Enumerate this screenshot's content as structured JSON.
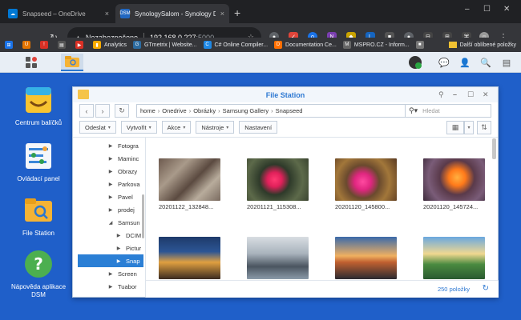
{
  "browser": {
    "tabs": [
      {
        "title": "Snapseed – OneDrive",
        "close": "×"
      },
      {
        "title": "SynologySalom - Synology Diski",
        "close": "×"
      }
    ],
    "new_tab": "+",
    "window_controls": [
      "–",
      "☐",
      "✕"
    ],
    "address": {
      "security": "Nezabezpečeno",
      "host": "192.168.0.227",
      "port": ":5000"
    },
    "bookmarks": [
      "Analytics",
      "GTmetrix | Website...",
      "C# Online Compiler...",
      "Documentation Ce...",
      "MSPRO.CZ - Inform..."
    ],
    "other_bookmarks": "Další oblíbené položky"
  },
  "desktop": {
    "icons": [
      {
        "label": "Centrum balíčků"
      },
      {
        "label": "Ovládací panel"
      },
      {
        "label": "File Station"
      },
      {
        "label": "Nápověda aplikace DSM"
      }
    ]
  },
  "file_station": {
    "title": "File Station",
    "path": [
      "home",
      "Onedrive",
      "Obrázky",
      "Samsung Gallery",
      "Snapseed"
    ],
    "search_placeholder": "Hledat",
    "actions": [
      {
        "label": "Odeslat",
        "has_dropdown": true
      },
      {
        "label": "Vytvořit",
        "has_dropdown": true
      },
      {
        "label": "Akce",
        "has_dropdown": true
      },
      {
        "label": "Nástroje",
        "has_dropdown": true
      },
      {
        "label": "Nastavení",
        "has_dropdown": false
      }
    ],
    "tree": [
      {
        "label": "Fotogra",
        "expanded": false,
        "selected": false
      },
      {
        "label": "Maminc",
        "expanded": false,
        "selected": false
      },
      {
        "label": "Obrazy",
        "expanded": false,
        "selected": false
      },
      {
        "label": "Parkova",
        "expanded": false,
        "selected": false
      },
      {
        "label": "Pavel",
        "expanded": false,
        "selected": false
      },
      {
        "label": "prodej",
        "expanded": false,
        "selected": false
      },
      {
        "label": "Samsun",
        "expanded": true,
        "selected": false
      },
      {
        "label": "DCIM",
        "expanded": false,
        "selected": false
      },
      {
        "label": "Pictur",
        "expanded": false,
        "selected": false
      },
      {
        "label": "Snap",
        "expanded": false,
        "selected": true
      },
      {
        "label": "Screen",
        "expanded": false,
        "selected": false
      },
      {
        "label": "Tuabor",
        "expanded": false,
        "selected": false
      }
    ],
    "files": [
      {
        "name": "20201122_132848..."
      },
      {
        "name": "20201121_115308..."
      },
      {
        "name": "20201120_145800..."
      },
      {
        "name": "20201120_145724..."
      },
      {
        "name": ""
      },
      {
        "name": ""
      },
      {
        "name": ""
      },
      {
        "name": ""
      }
    ],
    "item_count": "250 položky"
  }
}
